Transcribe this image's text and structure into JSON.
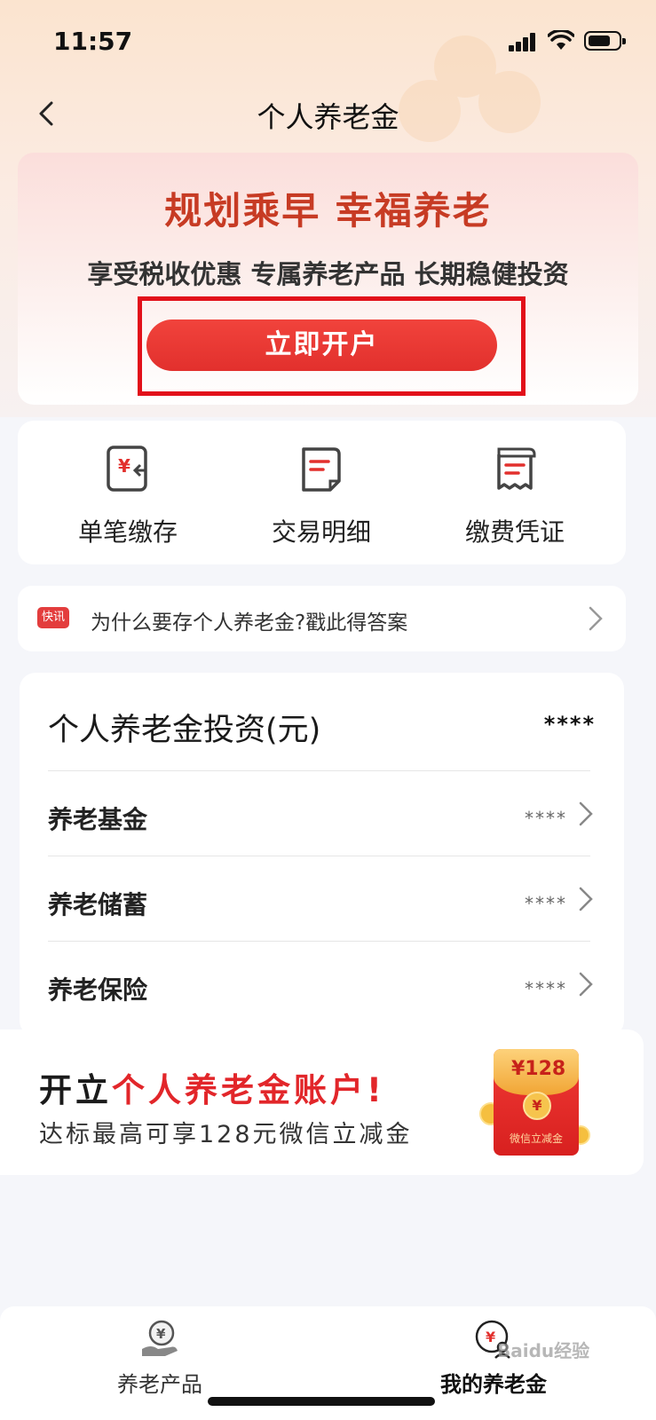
{
  "status_bar": {
    "time": "11:57"
  },
  "nav": {
    "title": "个人养老金"
  },
  "hero": {
    "title": "规划乘早 幸福养老",
    "subtitle": "享受税收优惠 专属养老产品 长期稳健投资",
    "open_button": "立即开户"
  },
  "quick_actions": [
    {
      "label": "单笔缴存",
      "icon": "yuan-deposit-icon"
    },
    {
      "label": "交易明细",
      "icon": "document-icon"
    },
    {
      "label": "缴费凭证",
      "icon": "receipt-icon"
    }
  ],
  "news": {
    "badge": "快讯",
    "text": "为什么要存个人养老金?戳此得答案"
  },
  "investment": {
    "title": "个人养老金投资(元)",
    "total": "****",
    "rows": [
      {
        "label": "养老基金",
        "value": "****"
      },
      {
        "label": "养老储蓄",
        "value": "****"
      },
      {
        "label": "养老保险",
        "value": "****"
      }
    ]
  },
  "promo": {
    "line1_prefix": "开立",
    "line1_highlight": "个人养老金账户!",
    "line2": "达标最高可享128元微信立减金",
    "envelope_amount": "¥128",
    "envelope_label": "微信立减金"
  },
  "tabbar": [
    {
      "label": "养老产品",
      "icon": "hand-yuan-icon"
    },
    {
      "label": "我的养老金",
      "icon": "user-yuan-icon"
    }
  ],
  "watermark": "Baidu经验",
  "colors": {
    "accent_red": "#e2302d",
    "title_red": "#c73b24",
    "highlight_box": "#e2101a"
  }
}
